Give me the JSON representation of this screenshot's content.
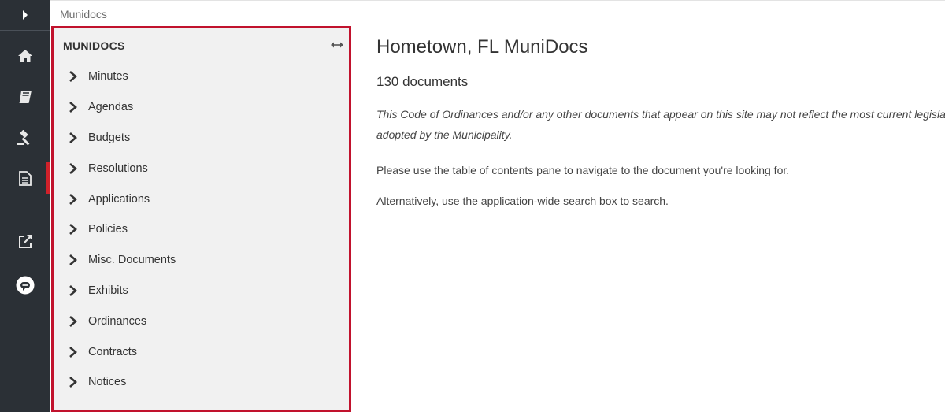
{
  "breadcrumb": {
    "label": "Munidocs"
  },
  "rail": {
    "items": [
      {
        "icon": "chevron-right-icon"
      },
      {
        "icon": "home-icon"
      },
      {
        "icon": "book-icon"
      },
      {
        "icon": "gavel-icon"
      },
      {
        "icon": "document-icon"
      },
      {
        "icon": "external-link-icon"
      },
      {
        "icon": "chat-bubble-icon"
      }
    ],
    "active_color": "#d0212a"
  },
  "toc": {
    "title": "MUNIDOCS",
    "items": [
      {
        "label": "Minutes"
      },
      {
        "label": "Agendas"
      },
      {
        "label": "Budgets"
      },
      {
        "label": "Resolutions"
      },
      {
        "label": "Applications"
      },
      {
        "label": "Policies"
      },
      {
        "label": "Misc. Documents"
      },
      {
        "label": "Exhibits"
      },
      {
        "label": "Ordinances"
      },
      {
        "label": "Contracts"
      },
      {
        "label": "Notices"
      }
    ],
    "highlight_color": "#c1122d"
  },
  "main": {
    "title": "Hometown, FL MuniDocs",
    "count": "130 documents",
    "disclaimer": "This Code of Ordinances and/or any other documents that appear on this site may not reflect the most current legislation adopted by the Municipality.",
    "paragraph1": "Please use the table of contents pane to navigate to the document you're looking for.",
    "paragraph2": "Alternatively, use the application-wide search box to search."
  }
}
